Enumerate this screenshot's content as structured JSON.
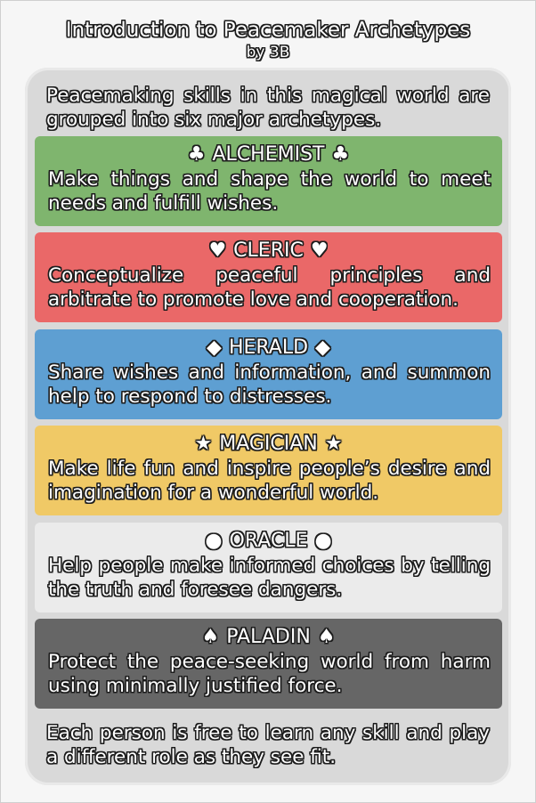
{
  "title": "Introduction to Peacemaker Archetypes",
  "subtitle": "by 3B",
  "intro": "Peacemaking skills in this magical world are grouped into six major archetypes.",
  "archetypes": [
    {
      "name": "ALCHEMIST",
      "symbol": "♣",
      "icon": "club-icon",
      "color": "#7fb56e",
      "description": "Make things and shape the world to meet needs and fulfill wishes."
    },
    {
      "name": "CLERIC",
      "symbol": "♥",
      "icon": "heart-icon",
      "color": "#ea6868",
      "description": "Conceptualize peaceful principles and arbitrate to promote love and cooperation."
    },
    {
      "name": "HERALD",
      "symbol": "◆",
      "icon": "diamond-icon",
      "color": "#5e9fd2",
      "description": "Share wishes and information, and summon help to respond to distresses."
    },
    {
      "name": "MAGICIAN",
      "symbol": "★",
      "icon": "star-icon",
      "color": "#f0c966",
      "description": "Make life fun and inspire people’s desire and imagination for a wonderful world."
    },
    {
      "name": "ORACLE",
      "symbol": "●",
      "icon": "circle-icon",
      "color": "#ebebeb",
      "description": "Help people make informed choices by telling the truth and foresee dangers."
    },
    {
      "name": "PALADIN",
      "symbol": "♠",
      "icon": "spade-icon",
      "color": "#666666",
      "description": "Protect the peace-seeking world from harm using minimally justified force."
    }
  ],
  "outro": "Each person is free to learn any skill and play a different role as they see fit."
}
